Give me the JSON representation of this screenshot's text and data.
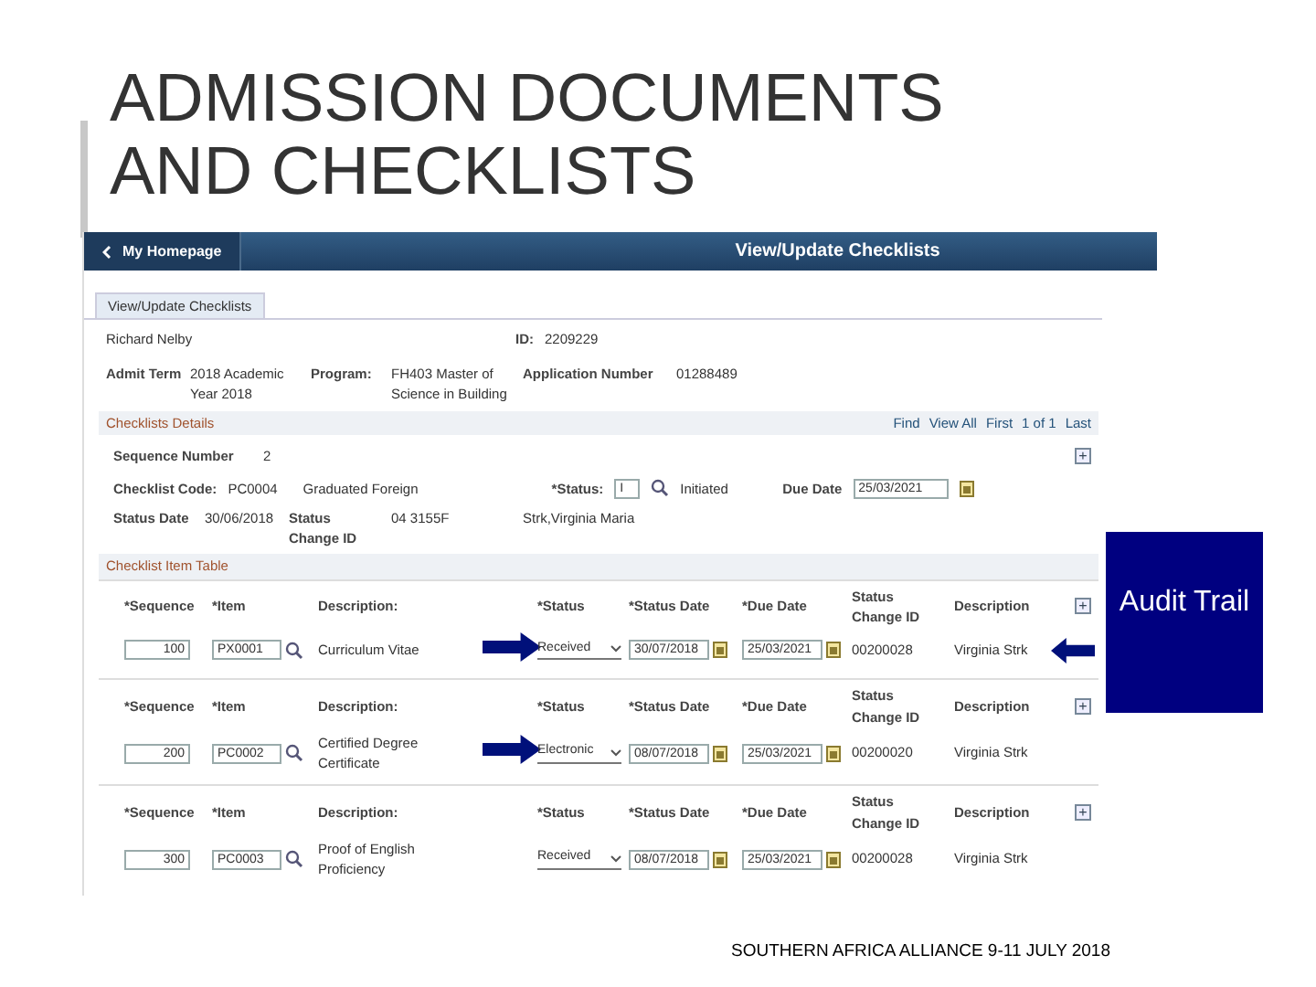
{
  "slide": {
    "title": "ADMISSION DOCUMENTS AND CHECKLISTS",
    "footer": "SOUTHERN AFRICA ALLIANCE  9-11 JULY 2018"
  },
  "screen": {
    "back_button": "My Homepage",
    "page_title": "View/Update Checklists",
    "tabs": [
      "View/Update Checklists"
    ],
    "student": {
      "name": "Richard Nelby",
      "id_label": "ID:",
      "id": "2209229"
    },
    "admission": [
      {
        "label": "Admit Term",
        "value": "2018   Academic Year 2018"
      },
      {
        "label": "Program:",
        "value": "FH403   Master of Science in Building"
      },
      {
        "label": "Application Number",
        "value": "01288489"
      }
    ],
    "checklist": {
      "title": "Checklists Details",
      "nav": [
        "Find",
        "View All",
        "First",
        "1 of 1",
        "Last"
      ],
      "sequence_label": "Sequence Number",
      "sequence": "2",
      "add_label": "+",
      "code_label": "Checklist Code:",
      "code": "PC0004",
      "code_description": "Graduated Foreign",
      "status_label": "*Status:",
      "status": "I",
      "status_description": "Initiated",
      "due_label": "Due Date",
      "due": "25/03/2021",
      "status_date_label": "Status Date",
      "status_date": "30/06/2018",
      "change_label": "Status Change ID",
      "change_id": "04 3155F",
      "changed_by": "Strk,Virginia Maria"
    },
    "item_table": {
      "title": "Checklist Item Table",
      "rows": [
        {
          "columns": [
            "*Sequence",
            "*Item",
            "Description:",
            "*Status",
            "*Status Date",
            "*Due Date",
            "Status Change ID",
            "Description"
          ],
          "add_label": "+",
          "sequence": "100",
          "item": "PX0001",
          "description": "Curriculum Vitae",
          "status": "Received",
          "status_date": "30/07/2018",
          "due_date": "25/03/2021",
          "change_id": "00200028",
          "changed_by": "Virginia Strk",
          "status_arrow": true,
          "trail_arrow": true
        },
        {
          "columns": [
            "*Sequence",
            "*Item",
            "Description:",
            "*Status",
            "*Status Date",
            "*Due Date",
            "Status Change ID",
            "Description"
          ],
          "add_label": "+",
          "sequence": "200",
          "item": "PC0002",
          "description": "Certified Degree Certificate",
          "status": "Electronic",
          "status_date": "08/07/2018",
          "due_date": "25/03/2021",
          "change_id": "00200020",
          "changed_by": "Virginia Strk",
          "status_arrow": true,
          "trail_arrow": false
        },
        {
          "columns": [
            "*Sequence",
            "*Item",
            "Description:",
            "*Status",
            "*Status Date",
            "*Due Date",
            "Status Change ID",
            "Description"
          ],
          "add_label": "+",
          "sequence": "300",
          "item": "PC0003",
          "description": "Proof of English Proficiency",
          "status": "Received",
          "status_date": "08/07/2018",
          "due_date": "25/03/2021",
          "change_id": "00200028",
          "changed_by": "Virginia Strk",
          "status_arrow": false,
          "trail_arrow": false
        }
      ]
    }
  },
  "callout": {
    "text": "Audit Trail"
  }
}
